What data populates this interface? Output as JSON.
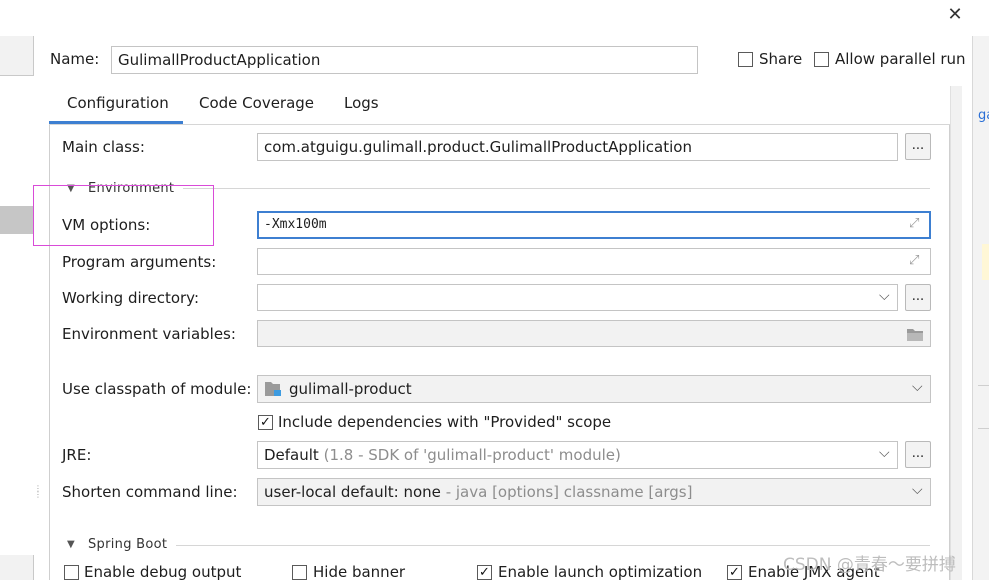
{
  "name": {
    "label": "Name:",
    "value": "GulimallProductApplication"
  },
  "header": {
    "share_label": "Share",
    "allow_parallel_label": "Allow parallel run"
  },
  "tabs": [
    {
      "label": "Configuration",
      "active": true
    },
    {
      "label": "Code Coverage",
      "active": false
    },
    {
      "label": "Logs",
      "active": false
    }
  ],
  "main_class": {
    "label": "Main class:",
    "value": "com.atguigu.gulimall.product.GulimallProductApplication"
  },
  "environment": {
    "section_label": "Environment",
    "vm_options": {
      "label": "VM options:",
      "value": "-Xmx100m"
    },
    "program_arguments": {
      "label": "Program arguments:",
      "value": ""
    },
    "working_directory": {
      "label": "Working directory:",
      "value": ""
    },
    "environment_variables": {
      "label": "Environment variables:",
      "value": ""
    }
  },
  "classpath": {
    "label": "Use classpath of module:",
    "value": "gulimall-product"
  },
  "include_dependencies": {
    "label": "Include dependencies with \"Provided\" scope",
    "checked": true
  },
  "jre": {
    "label": "JRE:",
    "value": "Default",
    "hint": "(1.8 - SDK of 'gulimall-product' module)"
  },
  "shorten_command_line": {
    "label": "Shorten command line:",
    "value": "user-local default: none",
    "hint": "- java [options] classname [args]"
  },
  "spring_boot": {
    "section_label": "Spring Boot",
    "options": [
      {
        "label": "Enable debug output",
        "checked": false
      },
      {
        "label": "Hide banner",
        "checked": false
      },
      {
        "label": "Enable launch optimization",
        "checked": true
      },
      {
        "label": "Enable JMX agent",
        "checked": true
      }
    ]
  },
  "watermark": "CSDN @青春～要拼搏",
  "right_edge_fragment": "ga",
  "colors": {
    "accent": "#3d7fd1",
    "highlight_box": "#d94bd8"
  },
  "icons": {
    "close": "close-icon",
    "expand": "expand-icon",
    "folder": "folder-icon",
    "module": "module-icon",
    "dropdown": "chevron-down-icon"
  }
}
